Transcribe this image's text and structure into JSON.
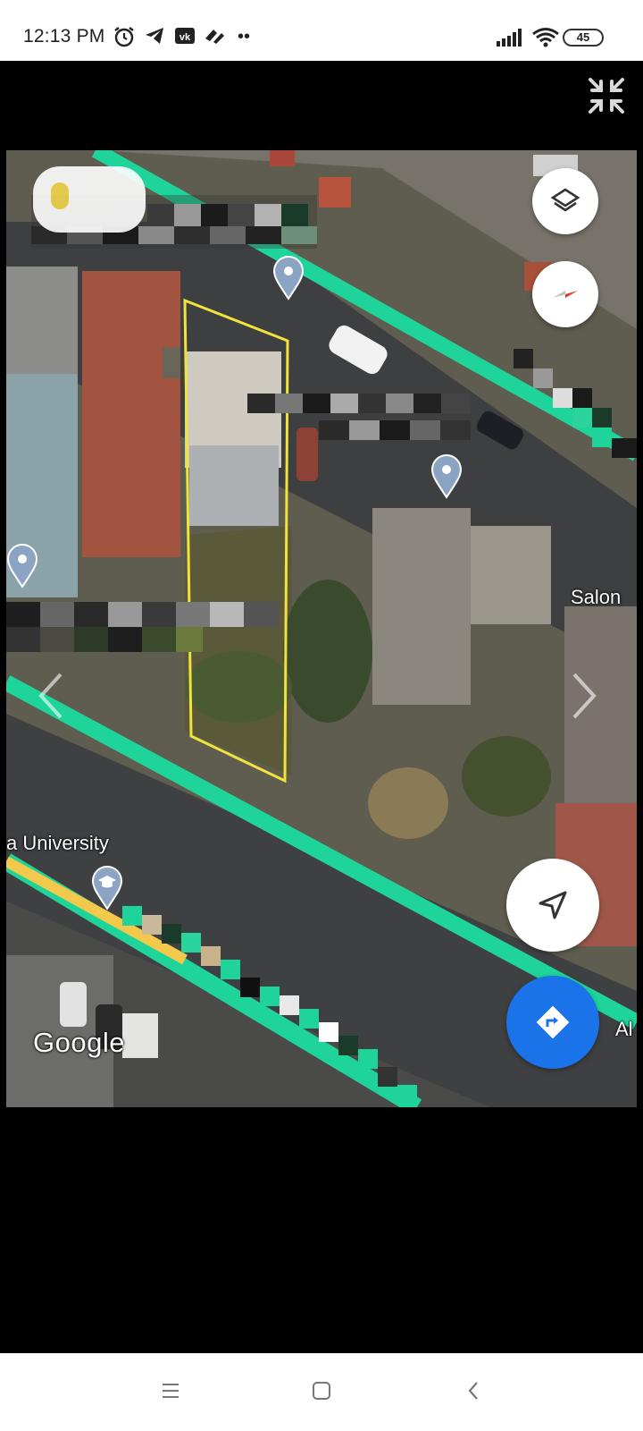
{
  "status_bar": {
    "time": "12:13 PM",
    "indicators": [
      "alarm-icon",
      "telegram-icon",
      "vk-icon",
      "app-icon",
      "more-icon"
    ],
    "signal": "signal-icon",
    "wifi": "wifi-icon",
    "battery": "45"
  },
  "viewer": {
    "collapse_icon": "collapse-fullscreen-icon"
  },
  "map": {
    "labels": {
      "salon": "Salon",
      "university": "a University",
      "road_edge": "Al"
    },
    "logo": "Google",
    "buttons": {
      "layers_icon": "layers-icon",
      "compass_icon": "compass-icon",
      "my_location_icon": "navigation-arrow-icon",
      "directions_icon": "directions-icon"
    },
    "colors": {
      "road_highlight": "#1fd49a",
      "boundary": "#f2e33a",
      "pin": "#8ba4c4",
      "directions_button": "#1a73e8"
    }
  },
  "nav_bar": {
    "items": [
      "menu-icon",
      "home-icon",
      "back-icon"
    ]
  }
}
